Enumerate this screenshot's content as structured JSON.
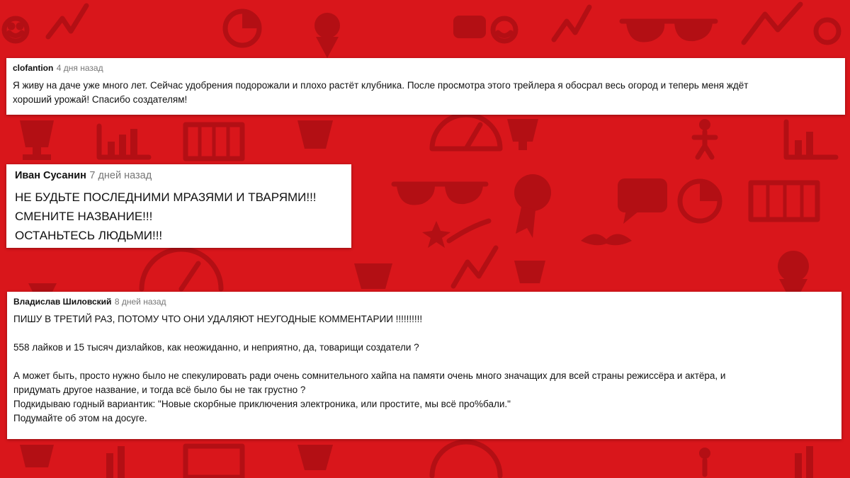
{
  "background": {
    "color": "#d9161b",
    "pattern_color": "#b30f14",
    "pattern_icons": [
      "smiley-icon",
      "trend-line-icon",
      "ice-cream-icon",
      "sunglasses-icon",
      "trophy-icon",
      "bar-chart-icon",
      "piano-icon",
      "gauge-icon",
      "award-ribbon-icon",
      "speech-bubble-icon",
      "pie-chart-icon",
      "play-button-icon",
      "mustache-icon",
      "shooting-star-icon",
      "donut-icon"
    ]
  },
  "comments": [
    {
      "author": "clofantion",
      "time": "4 дня назад",
      "lines": [
        "Я живу на даче уже много лет. Сейчас удобрения подорожали и плохо растёт клубника. После просмотра этого трейлера я обосрал весь огород и теперь меня ждёт",
        "хороший урожай! Спасибо создателям!"
      ]
    },
    {
      "author": "Иван Сусанин",
      "time": "7 дней назад",
      "lines": [
        "НЕ БУДЬТЕ ПОСЛЕДНИМИ МРАЗЯМИ И ТВАРЯМИ!!!",
        "СМЕНИТЕ НАЗВАНИЕ!!!",
        "ОСТАНЬТЕСЬ ЛЮДЬМИ!!!"
      ]
    },
    {
      "author": "Владислав Шиловский",
      "time": "8 дней назад",
      "lines": [
        "ПИШУ В ТРЕТИЙ РАЗ, ПОТОМУ ЧТО ОНИ УДАЛЯЮТ НЕУГОДНЫЕ КОММЕНТАРИИ !!!!!!!!!!",
        "558 лайков и 15 тысяч дизлайков, как неожиданно, и неприятно, да, товарищи создатели ?",
        "А может быть, просто нужно было не спекулировать ради очень сомнительного хайпа на памяти очень много значащих для всей страны режиссёра и актёра, и",
        "придумать другое название, и тогда всё было бы не так грустно ?",
        "Подкидываю годный вариантик: \"Новые скорбные приключения электроника, или простите, мы всё про%бали.\"",
        "Подумайте об этом на досуге."
      ]
    }
  ]
}
